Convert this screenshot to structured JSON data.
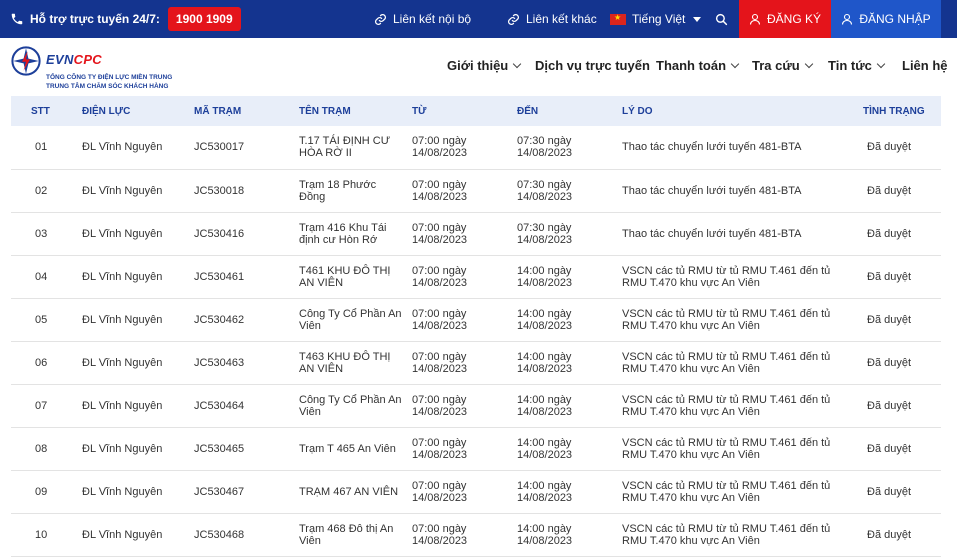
{
  "topbar": {
    "hotline_label": "Hỗ trợ trực tuyến 24/7:",
    "hotline_number": "1900 1909",
    "link_internal": "Liên kết nội bộ",
    "link_other": "Liên kết khác",
    "language": "Tiếng Việt",
    "register": "ĐĂNG KÝ",
    "login": "ĐĂNG NHẬP"
  },
  "logo": {
    "brand_a": "EVN",
    "brand_b": "CPC",
    "line1": "TỔNG CÔNG TY ĐIỆN LỰC MIỀN TRUNG",
    "line2": "TRUNG TÂM CHĂM SÓC KHÁCH HÀNG"
  },
  "nav": {
    "items": [
      {
        "label": "Giới thiệu"
      },
      {
        "label": "Dịch vụ trực tuyến"
      },
      {
        "label": "Thanh toán"
      },
      {
        "label": "Tra cứu"
      },
      {
        "label": "Tin tức"
      },
      {
        "label": "Liên hệ"
      }
    ]
  },
  "table": {
    "headers": [
      "STT",
      "ĐIỆN LỰC",
      "MÃ TRẠM",
      "TÊN TRẠM",
      "TỪ",
      "ĐẾN",
      "LÝ DO",
      "TÌNH TRẠNG"
    ],
    "rows": [
      {
        "stt": "01",
        "dien_luc": "ĐL Vĩnh Nguyên",
        "ma_tram": "JC530017",
        "ten_tram": "T.17 TÁI ĐỊNH CƯ HÒA RỜ II",
        "tu": "07:00 ngày 14/08/2023",
        "den": "07:30 ngày 14/08/2023",
        "ly_do": "Thao tác chuyển lưới tuyến 481-BTA",
        "tinh_trang": "Đã duyệt"
      },
      {
        "stt": "02",
        "dien_luc": "ĐL Vĩnh Nguyên",
        "ma_tram": "JC530018",
        "ten_tram": "Trạm 18 Phước Đồng",
        "tu": "07:00 ngày 14/08/2023",
        "den": "07:30 ngày 14/08/2023",
        "ly_do": "Thao tác chuyển lưới tuyến 481-BTA",
        "tinh_trang": "Đã duyệt"
      },
      {
        "stt": "03",
        "dien_luc": "ĐL Vĩnh Nguyên",
        "ma_tram": "JC530416",
        "ten_tram": "Trạm 416 Khu Tái định cư Hòn Rớ",
        "tu": "07:00 ngày 14/08/2023",
        "den": "07:30 ngày 14/08/2023",
        "ly_do": "Thao tác chuyển lưới tuyến 481-BTA",
        "tinh_trang": "Đã duyệt"
      },
      {
        "stt": "04",
        "dien_luc": "ĐL Vĩnh Nguyên",
        "ma_tram": "JC530461",
        "ten_tram": "T461 KHU ĐÔ THỊ AN VIÊN",
        "tu": "07:00 ngày 14/08/2023",
        "den": "14:00 ngày 14/08/2023",
        "ly_do": "VSCN các tủ RMU từ tủ RMU T.461 đến tủ RMU T.470 khu vực An Viên",
        "tinh_trang": "Đã duyệt"
      },
      {
        "stt": "05",
        "dien_luc": "ĐL Vĩnh Nguyên",
        "ma_tram": "JC530462",
        "ten_tram": "Công Ty Cổ Phần An Viên",
        "tu": "07:00 ngày 14/08/2023",
        "den": "14:00 ngày 14/08/2023",
        "ly_do": "VSCN các tủ RMU từ tủ RMU T.461 đến tủ RMU T.470 khu vực An Viên",
        "tinh_trang": "Đã duyệt"
      },
      {
        "stt": "06",
        "dien_luc": "ĐL Vĩnh Nguyên",
        "ma_tram": "JC530463",
        "ten_tram": "T463 KHU ĐÔ THỊ AN VIÊN",
        "tu": "07:00 ngày 14/08/2023",
        "den": "14:00 ngày 14/08/2023",
        "ly_do": "VSCN các tủ RMU từ tủ RMU T.461 đến tủ RMU T.470 khu vực An Viên",
        "tinh_trang": "Đã duyệt"
      },
      {
        "stt": "07",
        "dien_luc": "ĐL Vĩnh Nguyên",
        "ma_tram": "JC530464",
        "ten_tram": "Công Ty Cổ Phần An Viên",
        "tu": "07:00 ngày 14/08/2023",
        "den": "14:00 ngày 14/08/2023",
        "ly_do": "VSCN các tủ RMU từ tủ RMU T.461 đến tủ RMU T.470 khu vực An Viên",
        "tinh_trang": "Đã duyệt"
      },
      {
        "stt": "08",
        "dien_luc": "ĐL Vĩnh Nguyên",
        "ma_tram": "JC530465",
        "ten_tram": "Trạm T 465 An Viên",
        "tu": "07:00 ngày 14/08/2023",
        "den": "14:00 ngày 14/08/2023",
        "ly_do": "VSCN các tủ RMU từ tủ RMU T.461 đến tủ RMU T.470 khu vực An Viên",
        "tinh_trang": "Đã duyệt"
      },
      {
        "stt": "09",
        "dien_luc": "ĐL Vĩnh Nguyên",
        "ma_tram": "JC530467",
        "ten_tram": "TRẠM 467 AN VIÊN",
        "tu": "07:00 ngày 14/08/2023",
        "den": "14:00 ngày 14/08/2023",
        "ly_do": "VSCN các tủ RMU từ tủ RMU T.461 đến tủ RMU T.470 khu vực An Viên",
        "tinh_trang": "Đã duyệt"
      },
      {
        "stt": "10",
        "dien_luc": "ĐL Vĩnh Nguyên",
        "ma_tram": "JC530468",
        "ten_tram": "Trạm 468 Đô thị An Viên",
        "tu": "07:00 ngày 14/08/2023",
        "den": "14:00 ngày 14/08/2023",
        "ly_do": "VSCN các tủ RMU từ tủ RMU T.461 đến tủ RMU T.470 khu vực An Viên",
        "tinh_trang": "Đã duyệt"
      }
    ]
  },
  "colors": {
    "topbar_bg": "#14348f",
    "accent_red": "#e4141b",
    "login_blue": "#1f56c9",
    "header_text": "#1d3f9a",
    "table_head_bg": "#e8eef9"
  }
}
